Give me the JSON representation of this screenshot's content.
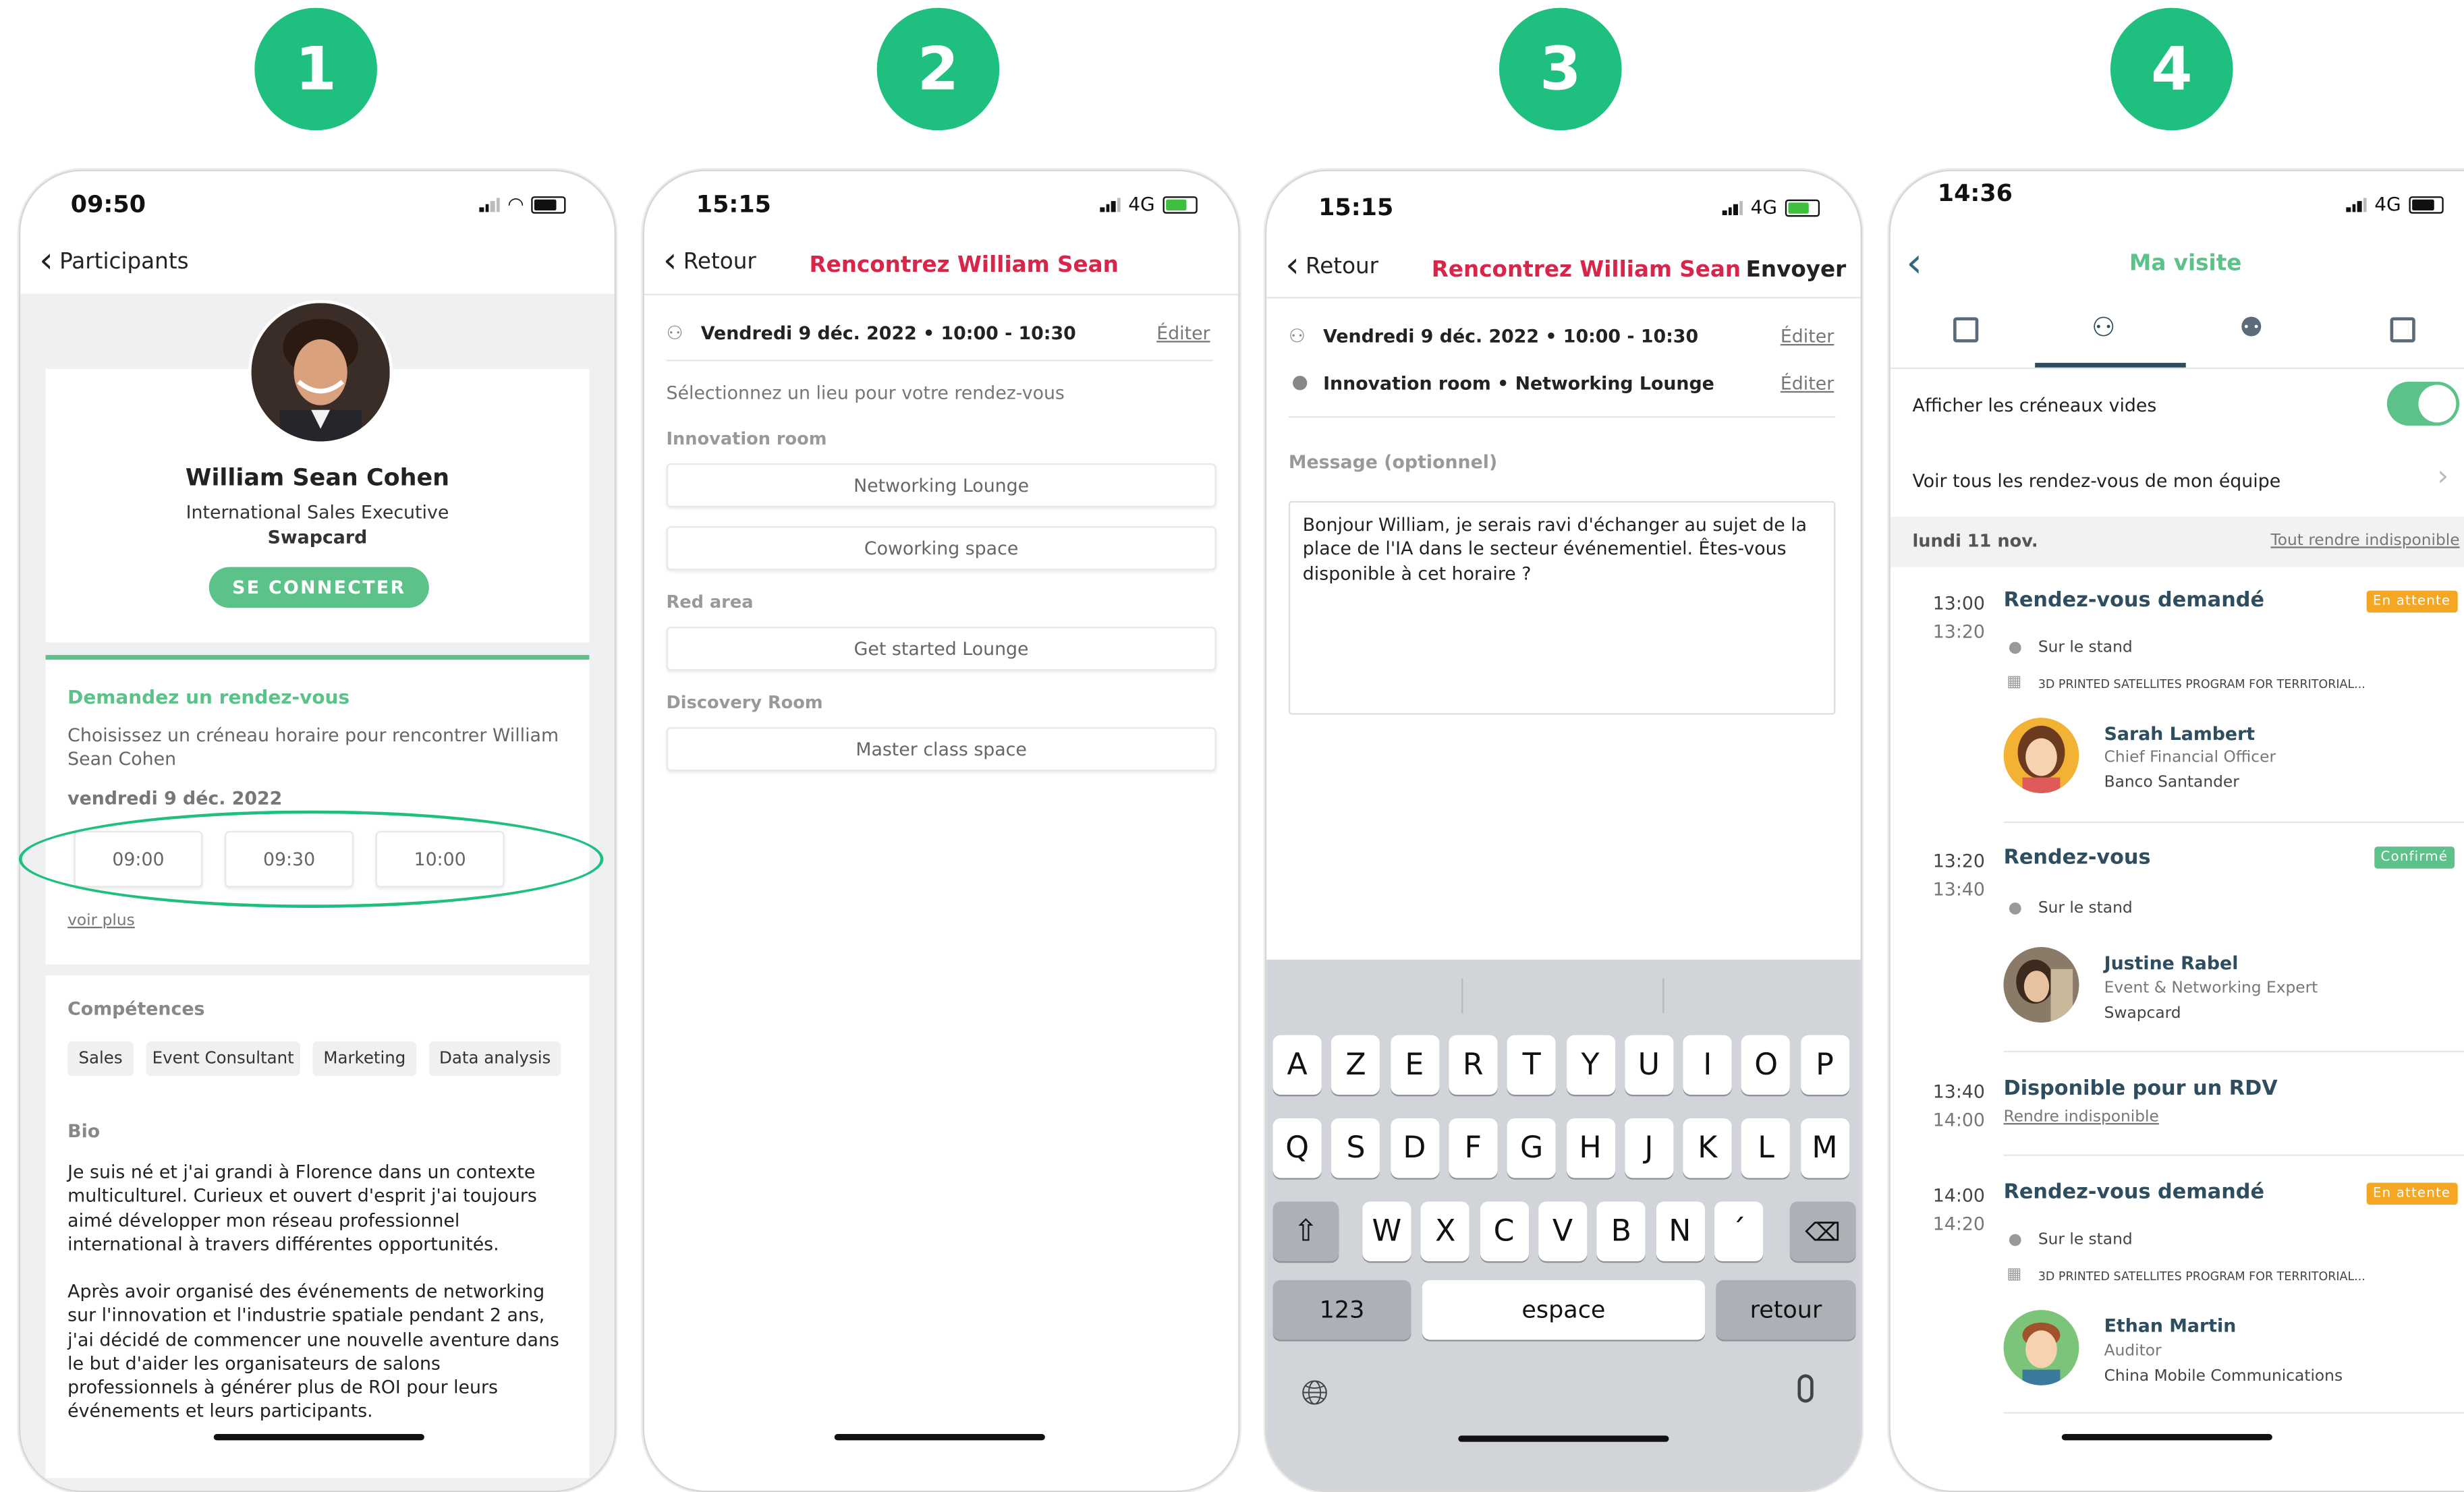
{
  "colors": {
    "accent_green": "#1fbf7f",
    "brand_red": "#d7264a",
    "pending_orange": "#f5a623",
    "confirmed_green": "#5cc28a"
  },
  "steps": [
    "1",
    "2",
    "3",
    "4"
  ],
  "screen1": {
    "time": "09:50",
    "back_label": "Participants",
    "name": "William Sean Cohen",
    "job": "International Sales Executive",
    "company": "Swapcard",
    "connect_button": "SE CONNECTER",
    "meeting_title": "Demandez un rendez-vous",
    "meeting_desc": "Choisissez un créneau horaire pour rencontrer William Sean Cohen",
    "date": "vendredi 9 déc. 2022",
    "slots": [
      "09:00",
      "09:30",
      "10:00"
    ],
    "see_more": "voir plus",
    "skills_title": "Compétences",
    "skills": [
      "Sales",
      "Event Consultant",
      "Marketing",
      "Data analysis"
    ],
    "bio_title": "Bio",
    "bio_lines_1": [
      "Je suis né et j'ai grandi à Florence dans un contexte",
      "multiculturel. Curieux et ouvert d'esprit j'ai toujours",
      "aimé développer mon réseau professionnel",
      "international à travers différentes opportunités."
    ],
    "bio_lines_2": [
      "Après avoir organisé des événements de networking",
      "sur l'innovation et l'industrie spatiale pendant 2 ans,",
      "j'ai décidé de commencer une nouvelle aventure dans",
      "le but d'aider les organisateurs de salons",
      "professionnels à générer plus de ROI pour leurs",
      "événements et leurs participants."
    ]
  },
  "screen2": {
    "time": "15:15",
    "network": "4G",
    "back_label": "Retour",
    "title": "Rencontrez William Sean",
    "date_line": "Vendredi 9 déc. 2022 • 10:00 - 10:30",
    "edit": "Éditer",
    "prompt": "Sélectionnez un lieu pour votre rendez-vous",
    "groups": [
      {
        "name": "Innovation room",
        "items": [
          "Networking Lounge",
          "Coworking space"
        ]
      },
      {
        "name": "Red area",
        "items": [
          "Get started Lounge"
        ]
      },
      {
        "name": "Discovery Room",
        "items": [
          "Master class space"
        ]
      }
    ]
  },
  "screen3": {
    "time": "15:15",
    "network": "4G",
    "back_label": "Retour",
    "title": "Rencontrez William Sean",
    "send": "Envoyer",
    "date_line": "Vendredi 9 déc. 2022 • 10:00 - 10:30",
    "location_line": "Innovation room • Networking Lounge",
    "edit": "Éditer",
    "message_label": "Message (optionnel)",
    "message_lines": [
      "Bonjour William, je serais ravi d'échanger au sujet de la",
      "place de l'IA dans le secteur événementiel. Êtes-vous",
      "disponible à cet horaire ?"
    ],
    "keyboard_row1": [
      "A",
      "Z",
      "E",
      "R",
      "T",
      "Y",
      "U",
      "I",
      "O",
      "P"
    ],
    "keyboard_row2": [
      "Q",
      "S",
      "D",
      "F",
      "G",
      "H",
      "J",
      "K",
      "L",
      "M"
    ],
    "keyboard_row3": [
      "W",
      "X",
      "C",
      "V",
      "B",
      "N",
      "´"
    ],
    "key_123": "123",
    "key_space": "espace",
    "key_return": "retour"
  },
  "screen4": {
    "time": "14:36",
    "network": "4G",
    "title": "Ma visite",
    "toggle_label": "Afficher les créneaux vides",
    "team_link": "Voir tous les rendez-vous de mon équipe",
    "day": "lundi 11 nov.",
    "unavailable_all": "Tout rendre indisponible",
    "entries": [
      {
        "start": "13:00",
        "end": "13:20",
        "title": "Rendez-vous demandé",
        "badge": "En attente",
        "place": "Sur le stand",
        "exhibitor": "3D PRINTED SATELLITES PROGRAM FOR TERRITORIAL...",
        "person": "Sarah Lambert",
        "role": "Chief Financial Officer",
        "company": "Banco Santander"
      },
      {
        "start": "13:20",
        "end": "13:40",
        "title": "Rendez-vous",
        "badge": "Confirmé",
        "place": "Sur le stand",
        "person": "Justine Rabel",
        "role": "Event & Networking Expert",
        "company": "Swapcard"
      },
      {
        "start": "13:40",
        "end": "14:00",
        "title": "Disponible pour un RDV",
        "action": "Rendre indisponible"
      },
      {
        "start": "14:00",
        "end": "14:20",
        "title": "Rendez-vous demandé",
        "badge": "En attente",
        "place": "Sur le stand",
        "exhibitor": "3D PRINTED SATELLITES PROGRAM FOR TERRITORIAL...",
        "person": "Ethan Martin",
        "role": "Auditor",
        "company": "China Mobile Communications"
      }
    ]
  }
}
